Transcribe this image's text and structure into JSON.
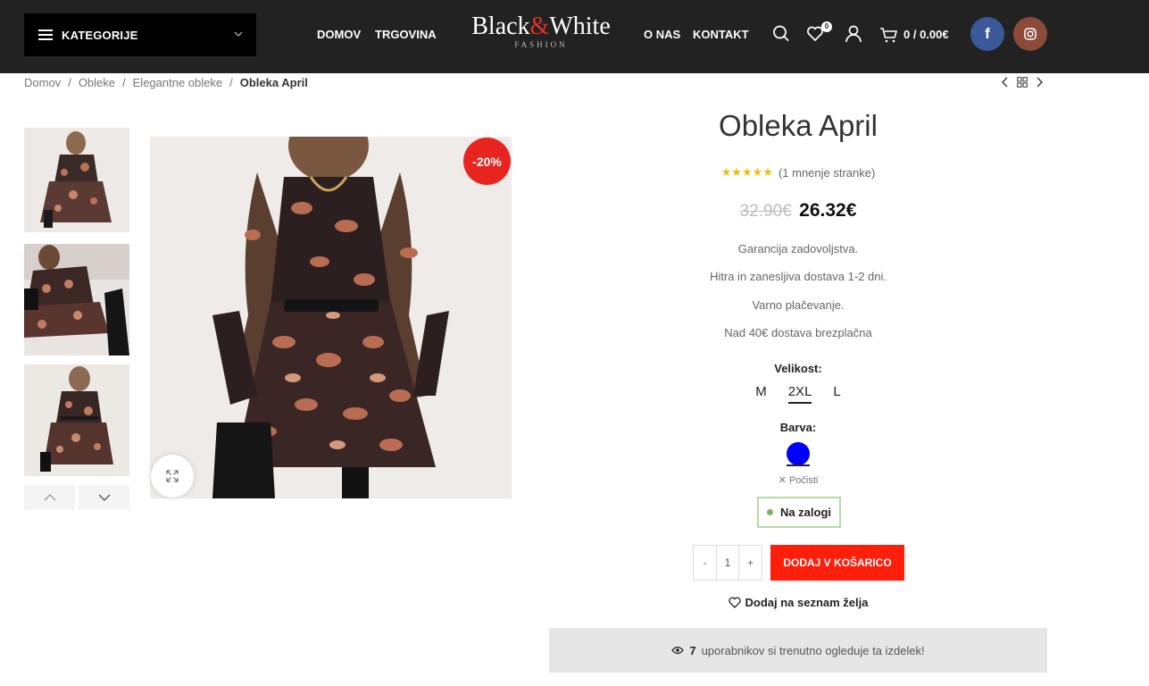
{
  "header": {
    "categories_label": "KATEGORIJE",
    "nav_left": [
      "DOMOV",
      "TRGOVINA"
    ],
    "logo": {
      "part1": "Black",
      "amp": "&",
      "part2": "White",
      "sub": "FASHION"
    },
    "nav_right": [
      "O NAS",
      "KONTAKT"
    ],
    "wishlist_count": "0",
    "cart_summary": "0 / 0.00€",
    "icons": [
      "search-icon",
      "heart-icon",
      "user-icon",
      "cart-icon",
      "facebook-icon",
      "instagram-icon"
    ]
  },
  "breadcrumb": {
    "items": [
      "Domov",
      "Obleke",
      "Elegantne obleke"
    ],
    "separator": "/",
    "current": "Obleka April"
  },
  "gallery": {
    "sale_badge": "-20%",
    "thumbnail_count": 3
  },
  "product": {
    "title": "Obleka April",
    "stars": "★★★★★",
    "rating_value": 5,
    "reviews_text": "(1 mnenje stranke)",
    "old_price": "32.90€",
    "price": "26.32€",
    "info_lines": [
      "Garancija zadovoljstva.",
      "Hitra in zanesljiva dostava 1-2 dni.",
      "Varno plačevanje.",
      "Nad 40€ dostava brezplačna"
    ],
    "size_label": "Velikost",
    "sizes": [
      "M",
      "2XL",
      "L"
    ],
    "selected_size": "2XL",
    "color_label": "Barva",
    "selected_color": "#0000ff",
    "clear_label": "Počisti",
    "stock_label": "Na zalogi",
    "quantity": "1",
    "minus": "-",
    "plus": "+",
    "add_to_cart": "DODAJ V KOŠARICO",
    "wishlist_label": "Dodaj na seznam želja",
    "viewers_count": "7",
    "viewers_text": "uporabnikov si trenutno ogleduje ta izdelek!"
  },
  "colors": {
    "header_bg": "#222222",
    "accent_red": "#fd1e0c",
    "sale_red": "#e8241e",
    "star": "#eabe12",
    "facebook": "#3b5998",
    "instagram": "#8a4b3a"
  }
}
